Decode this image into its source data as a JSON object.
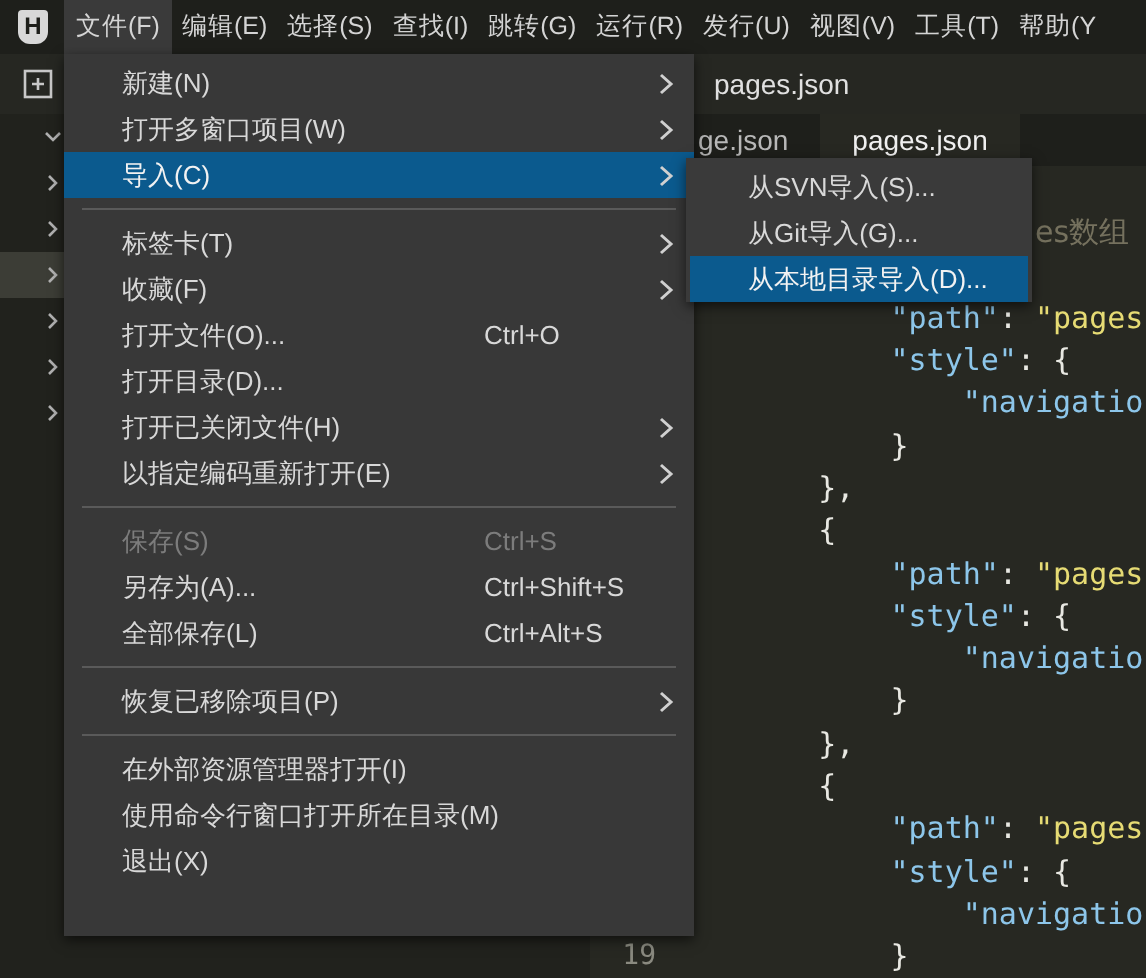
{
  "menubar": {
    "logo": "H",
    "items": [
      {
        "label": "文件(F)",
        "selected": true
      },
      {
        "label": "编辑(E)",
        "selected": false
      },
      {
        "label": "选择(S)",
        "selected": false
      },
      {
        "label": "查找(I)",
        "selected": false
      },
      {
        "label": "跳转(G)",
        "selected": false
      },
      {
        "label": "运行(R)",
        "selected": false
      },
      {
        "label": "发行(U)",
        "selected": false
      },
      {
        "label": "视图(V)",
        "selected": false
      },
      {
        "label": "工具(T)",
        "selected": false
      },
      {
        "label": "帮助(Y",
        "selected": false
      }
    ]
  },
  "toolbar": {
    "breadcrumb": "pages.json"
  },
  "sidebar": {
    "items": [
      {
        "expanded": true,
        "selected": false
      },
      {
        "expanded": false,
        "selected": false
      },
      {
        "expanded": false,
        "selected": false
      },
      {
        "expanded": false,
        "selected": true
      },
      {
        "expanded": false,
        "selected": false
      },
      {
        "expanded": false,
        "selected": false
      },
      {
        "expanded": false,
        "selected": false
      }
    ]
  },
  "tabs": [
    {
      "label": "ge.json",
      "selected": false
    },
    {
      "label": "pages.json",
      "selected": true
    }
  ],
  "editor": {
    "lines": [
      {
        "kind": "comment",
        "text": "                es数组"
      },
      {
        "kind": "blank"
      },
      {
        "kind": "code",
        "text": "        \"path\": \"pages"
      },
      {
        "kind": "code",
        "text": "        \"style\": {"
      },
      {
        "kind": "code",
        "text": "            \"navigatio"
      },
      {
        "kind": "code",
        "text": "        }"
      },
      {
        "kind": "code",
        "text": "    },"
      },
      {
        "kind": "code",
        "text": "    {"
      },
      {
        "kind": "code",
        "text": "        \"path\": \"pages"
      },
      {
        "kind": "code",
        "text": "        \"style\": {"
      },
      {
        "kind": "code",
        "text": "            \"navigatio"
      },
      {
        "kind": "code",
        "text": "        }"
      },
      {
        "kind": "code",
        "text": "    },"
      },
      {
        "kind": "code",
        "text": "    {"
      },
      {
        "kind": "code",
        "text": "        \"path\": \"pages"
      },
      {
        "kind": "code",
        "text": "        \"style\": {"
      },
      {
        "kind": "code",
        "text": "            \"navigatio"
      },
      {
        "kind": "code",
        "text": "        }",
        "number": "19"
      }
    ]
  },
  "file_menu": {
    "items": [
      {
        "kind": "item",
        "label": "新建(N)",
        "submenu": true,
        "disabled": false,
        "selected": false
      },
      {
        "kind": "item",
        "label": "打开多窗口项目(W)",
        "submenu": true,
        "disabled": false,
        "selected": false
      },
      {
        "kind": "item",
        "label": "导入(C)",
        "submenu": true,
        "disabled": false,
        "selected": true
      },
      {
        "kind": "separator"
      },
      {
        "kind": "item",
        "label": "标签卡(T)",
        "submenu": true,
        "disabled": false,
        "selected": false
      },
      {
        "kind": "item",
        "label": "收藏(F)",
        "submenu": true,
        "disabled": false,
        "selected": false
      },
      {
        "kind": "item",
        "label": "打开文件(O)...",
        "shortcut": "Ctrl+O",
        "submenu": false,
        "disabled": false,
        "selected": false
      },
      {
        "kind": "item",
        "label": "打开目录(D)...",
        "submenu": false,
        "disabled": false,
        "selected": false
      },
      {
        "kind": "item",
        "label": "打开已关闭文件(H)",
        "submenu": true,
        "disabled": false,
        "selected": false
      },
      {
        "kind": "item",
        "label": "以指定编码重新打开(E)",
        "submenu": true,
        "disabled": false,
        "selected": false
      },
      {
        "kind": "separator"
      },
      {
        "kind": "item",
        "label": "保存(S)",
        "shortcut": "Ctrl+S",
        "submenu": false,
        "disabled": true,
        "selected": false
      },
      {
        "kind": "item",
        "label": "另存为(A)...",
        "shortcut": "Ctrl+Shift+S",
        "submenu": false,
        "disabled": false,
        "selected": false
      },
      {
        "kind": "item",
        "label": "全部保存(L)",
        "shortcut": "Ctrl+Alt+S",
        "submenu": false,
        "disabled": false,
        "selected": false
      },
      {
        "kind": "separator"
      },
      {
        "kind": "item",
        "label": "恢复已移除项目(P)",
        "submenu": true,
        "disabled": false,
        "selected": false
      },
      {
        "kind": "separator"
      },
      {
        "kind": "item",
        "label": "在外部资源管理器打开(I)",
        "submenu": false,
        "disabled": false,
        "selected": false
      },
      {
        "kind": "item",
        "label": "使用命令行窗口打开所在目录(M)",
        "submenu": false,
        "disabled": false,
        "selected": false
      },
      {
        "kind": "item",
        "label": "退出(X)",
        "submenu": false,
        "disabled": false,
        "selected": false
      }
    ]
  },
  "import_submenu": {
    "items": [
      {
        "kind": "item",
        "label": "从SVN导入(S)...",
        "disabled": false,
        "selected": false
      },
      {
        "kind": "item",
        "label": "从Git导入(G)...",
        "disabled": false,
        "selected": false
      },
      {
        "kind": "item",
        "label": "从本地目录导入(D)...",
        "disabled": false,
        "selected": true
      }
    ]
  }
}
